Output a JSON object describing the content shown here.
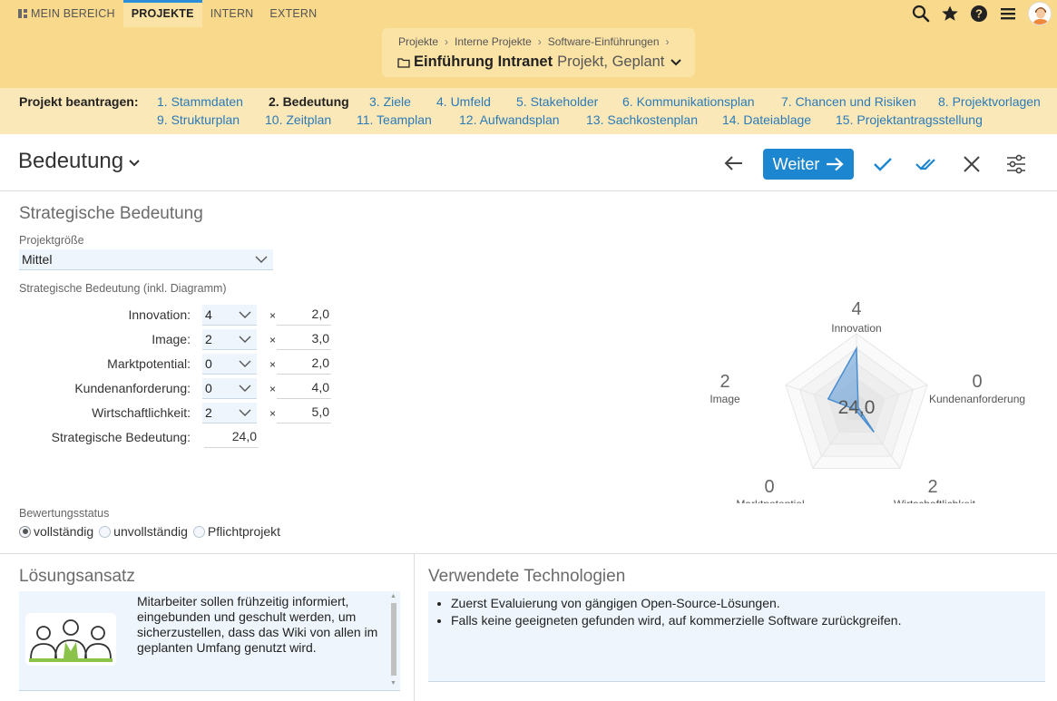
{
  "topnav": {
    "items": [
      "MEIN BEREICH",
      "PROJEKTE",
      "INTERN",
      "EXTERN"
    ],
    "active": "PROJEKTE"
  },
  "breadcrumb": {
    "items": [
      "Projekte",
      "Interne Projekte",
      "Software-Einführungen"
    ],
    "project_name": "Einführung Intranet",
    "project_sub": "Projekt, Geplant"
  },
  "steps": {
    "label": "Projekt beantragen:",
    "items": [
      "1. Stammdaten",
      "2. Bedeutung",
      "3. Ziele",
      "4. Umfeld",
      "5. Stakeholder",
      "6. Kommunikationsplan",
      "7. Chancen und Risiken",
      "8. Projektvorlagen",
      "9. Strukturplan",
      "10. Zeitplan",
      "11. Teamplan",
      "12. Aufwandsplan",
      "13. Sachkostenplan",
      "14. Dateiablage",
      "15. Projektantragsstellung"
    ],
    "current": "2. Bedeutung"
  },
  "header": {
    "title": "Bedeutung",
    "next_label": "Weiter"
  },
  "strategic": {
    "section_title": "Strategische Bedeutung",
    "size_label": "Projektgröße",
    "size_value": "Mittel",
    "sub_label": "Strategische Bedeutung (inkl. Diagramm)",
    "times": "×",
    "rows": [
      {
        "label": "Innovation:",
        "value": "4",
        "weight": "2,0"
      },
      {
        "label": "Image:",
        "value": "2",
        "weight": "3,0"
      },
      {
        "label": "Marktpotential:",
        "value": "0",
        "weight": "2,0"
      },
      {
        "label": "Kundenanforderung:",
        "value": "0",
        "weight": "4,0"
      },
      {
        "label": "Wirtschaftlichkeit:",
        "value": "2",
        "weight": "5,0"
      }
    ],
    "total_label": "Strategische Bedeutung:",
    "total_value": "24,0",
    "status_label": "Bewertungsstatus",
    "status_options": [
      "vollständig",
      "unvollständig",
      "Pflichtprojekt"
    ],
    "status_selected": "vollständig"
  },
  "chart_data": {
    "type": "radar",
    "axes": [
      "Innovation",
      "Kundenanforderung",
      "Wirtschaftlichkeit",
      "Marktpotential",
      "Image"
    ],
    "values": [
      4,
      0,
      2,
      0,
      2
    ],
    "max": 5,
    "center_label": "24,0",
    "colors": {
      "fill": "#5b9bd8",
      "stroke": "#4a8ed0",
      "grid": "#e6e6e6"
    }
  },
  "loesung": {
    "title": "Lösungsansatz",
    "text": "Mitarbeiter sollen frühzeitig informiert, eingebunden und geschult werden, um sicherzustellen, dass das Wiki von allen im geplanten Umfang genutzt wird."
  },
  "technologien": {
    "title": "Verwendete Technologien",
    "items": [
      "Zuerst Evaluierung von gängigen Open-Source-Lösungen.",
      "Falls keine geeigneten gefunden wird, auf kommerzielle Software zurückgreifen."
    ]
  }
}
